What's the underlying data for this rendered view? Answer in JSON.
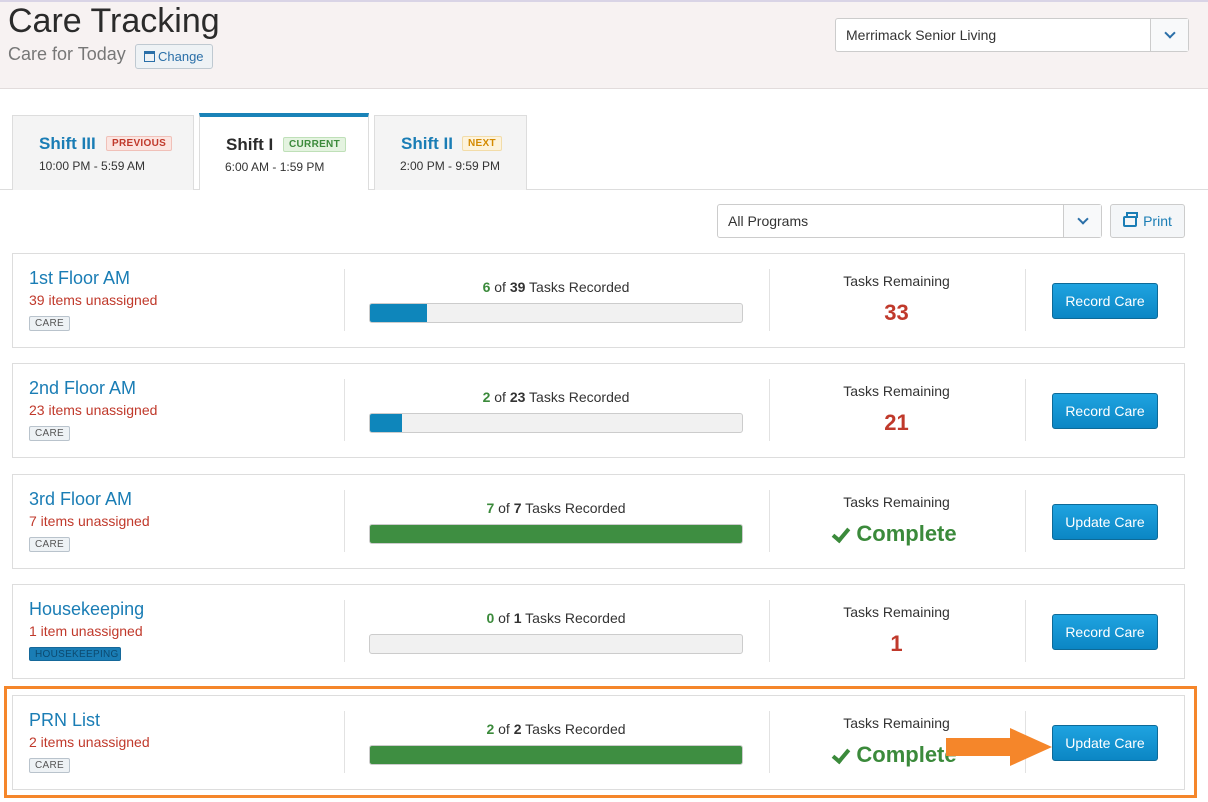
{
  "header": {
    "title": "Care Tracking",
    "subtitle": "Care for Today",
    "change_label": "Change",
    "community_select": "Merrimack Senior Living"
  },
  "tabs": [
    {
      "name": "Shift III",
      "badge": "PREVIOUS",
      "time": "10:00 PM - 5:59 AM",
      "active": false
    },
    {
      "name": "Shift I",
      "badge": "CURRENT",
      "time": "6:00 AM - 1:59 PM",
      "active": true
    },
    {
      "name": "Shift II",
      "badge": "NEXT",
      "time": "2:00 PM - 9:59 PM",
      "active": false
    }
  ],
  "toolbar": {
    "programs_select": "All Programs",
    "print_label": "Print"
  },
  "cards": [
    {
      "name": "1st Floor AM",
      "unassigned": "39 items unassigned",
      "tag": "CARE",
      "done": "6",
      "of_text": "of",
      "total": "39",
      "recorded_text": "Tasks Recorded",
      "progress": 0.154,
      "remaining_label": "Tasks Remaining",
      "remaining": "33",
      "button": "Record Care"
    },
    {
      "name": "2nd Floor AM",
      "unassigned": "23 items unassigned",
      "tag": "CARE",
      "done": "2",
      "of_text": "of",
      "total": "23",
      "recorded_text": "Tasks Recorded",
      "progress": 0.087,
      "remaining_label": "Tasks Remaining",
      "remaining": "21",
      "button": "Record Care"
    },
    {
      "name": "3rd Floor AM",
      "unassigned": "7 items unassigned",
      "tag": "CARE",
      "done": "7",
      "of_text": "of",
      "total": "7",
      "recorded_text": "Tasks Recorded",
      "progress": 1.0,
      "remaining_label": "Tasks Remaining",
      "remaining": "Complete",
      "button": "Update Care"
    },
    {
      "name": "Housekeeping",
      "unassigned": "1 item unassigned",
      "tag": "HOUSEKEEPING",
      "done": "0",
      "of_text": "of",
      "total": "1",
      "recorded_text": "Tasks Recorded",
      "progress": 0.0,
      "remaining_label": "Tasks Remaining",
      "remaining": "1",
      "button": "Record Care"
    },
    {
      "name": "PRN List",
      "unassigned": "2 items unassigned",
      "tag": "CARE",
      "done": "2",
      "of_text": "of",
      "total": "2",
      "recorded_text": "Tasks Recorded",
      "progress": 1.0,
      "remaining_label": "Tasks Remaining",
      "remaining": "Complete",
      "button": "Update Care"
    }
  ],
  "colors": {
    "partial_bar": "#0e86bb",
    "complete_bar": "#3e8e41",
    "highlight": "#f5862a"
  }
}
